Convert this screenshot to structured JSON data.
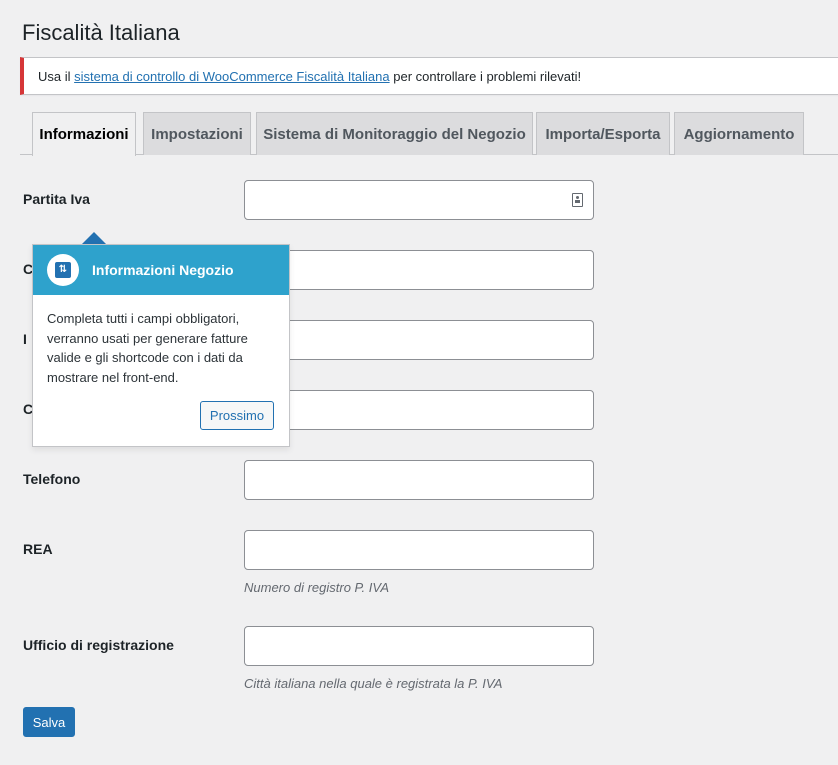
{
  "page": {
    "title": "Fiscalità Italiana"
  },
  "notice": {
    "prefix": "Usa il ",
    "link": "sistema di controllo di WooCommerce Fiscalità Italiana",
    "suffix": " per controllare i problemi rilevati!"
  },
  "tabs": [
    {
      "label": "Informazioni",
      "active": true
    },
    {
      "label": "Impostazioni",
      "active": false
    },
    {
      "label": "Sistema di Monitoraggio del Negozio",
      "active": false
    },
    {
      "label": "Importa/Esporta",
      "active": false
    },
    {
      "label": "Aggiornamento",
      "active": false
    }
  ],
  "form": {
    "fields": [
      {
        "label": "Partita Iva",
        "value": ""
      },
      {
        "label": "C",
        "value": ""
      },
      {
        "label": "I",
        "value": ""
      },
      {
        "label": "C",
        "value": ""
      },
      {
        "label": "Telefono",
        "value": ""
      },
      {
        "label": "REA",
        "value": "",
        "description": "Numero di registro P. IVA"
      },
      {
        "label": "Ufficio di registrazione",
        "value": "",
        "description": "Città italiana nella quale è registrata la P. IVA"
      }
    ],
    "save_label": "Salva"
  },
  "popover": {
    "title": "Informazioni Negozio",
    "body": "Completa tutti i campi obbligatori, verranno usati per generare fatture valide e gli shortcode con i dati da mostrare nel front-end.",
    "next_label": "Prossimo"
  },
  "colors": {
    "accent": "#2271b1",
    "popover_header": "#2ea2cc",
    "notice_border": "#d63638",
    "background": "#f0f0f1"
  }
}
